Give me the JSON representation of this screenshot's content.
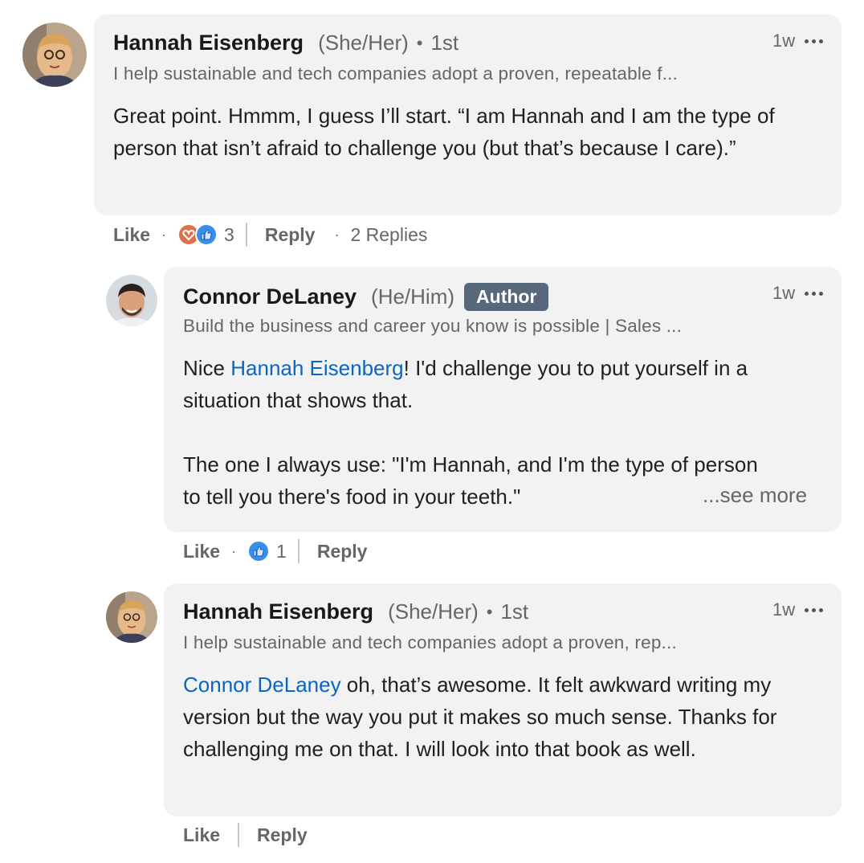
{
  "comments": [
    {
      "author": "Hannah Eisenberg",
      "pronouns": "(She/Her)",
      "degree": "1st",
      "headline": "I help sustainable and tech companies adopt a proven, repeatable f...",
      "time": "1w",
      "body": "Great point. Hmmm, I guess I’ll start. “I am Hannah and I am the type of person that isn’t afraid to challenge you (but that’s because I care).”",
      "actions": {
        "like": "Like",
        "reaction_count": "3",
        "reply": "Reply",
        "replies": "2 Replies"
      },
      "reaction_icons": [
        "love-icon",
        "like-icon"
      ]
    },
    {
      "author": "Connor DeLaney",
      "pronouns": "(He/Him)",
      "badge": "Author",
      "headline": "Build the business and career you know is possible | Sales ...",
      "time": "1w",
      "body_mention": "Hannah Eisenberg",
      "body_after_mention": "! I'd challenge you to put yourself in a situation that shows that.",
      "body_prefix": "Nice ",
      "body_para2": "The one I always use: \"I'm Hannah, and I'm the type of person to tell you there's food in your teeth.\"",
      "see_more": "...see more",
      "actions": {
        "like": "Like",
        "reaction_count": "1",
        "reply": "Reply"
      },
      "reaction_icons": [
        "like-icon"
      ]
    },
    {
      "author": "Hannah Eisenberg",
      "pronouns": "(She/Her)",
      "degree": "1st",
      "headline": "I help sustainable and tech companies adopt a proven, rep...",
      "time": "1w",
      "body_mention": "Connor DeLaney",
      "body_after_mention": " oh, that’s awesome. It felt awkward writing my version but the way you put it makes so much sense. Thanks for challenging me on that. I will look into that book as well.",
      "actions": {
        "like": "Like",
        "reply": "Reply"
      }
    }
  ],
  "colors": {
    "bubble": "#f2f2f2",
    "link": "#0a66c2",
    "badge": "#56687a",
    "like_blue": "#378fe9",
    "love_red": "#df704d"
  }
}
